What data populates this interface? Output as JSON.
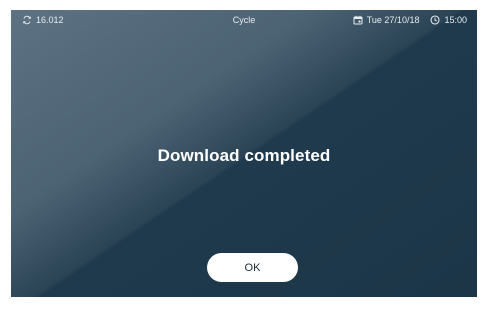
{
  "status_bar": {
    "counter_icon": "cycle-arrows-icon",
    "counter_value": "16.012",
    "title": "Cycle",
    "calendar_icon": "calendar-icon",
    "date": "Tue 27/10/18",
    "clock_icon": "clock-icon",
    "time": "15:00"
  },
  "dialog": {
    "message": "Download completed",
    "ok_label": "OK"
  },
  "colors": {
    "background_light": "#5d7282",
    "background_dark": "#1c3648",
    "button_bg": "#ffffff",
    "button_text": "#1f2a33"
  }
}
